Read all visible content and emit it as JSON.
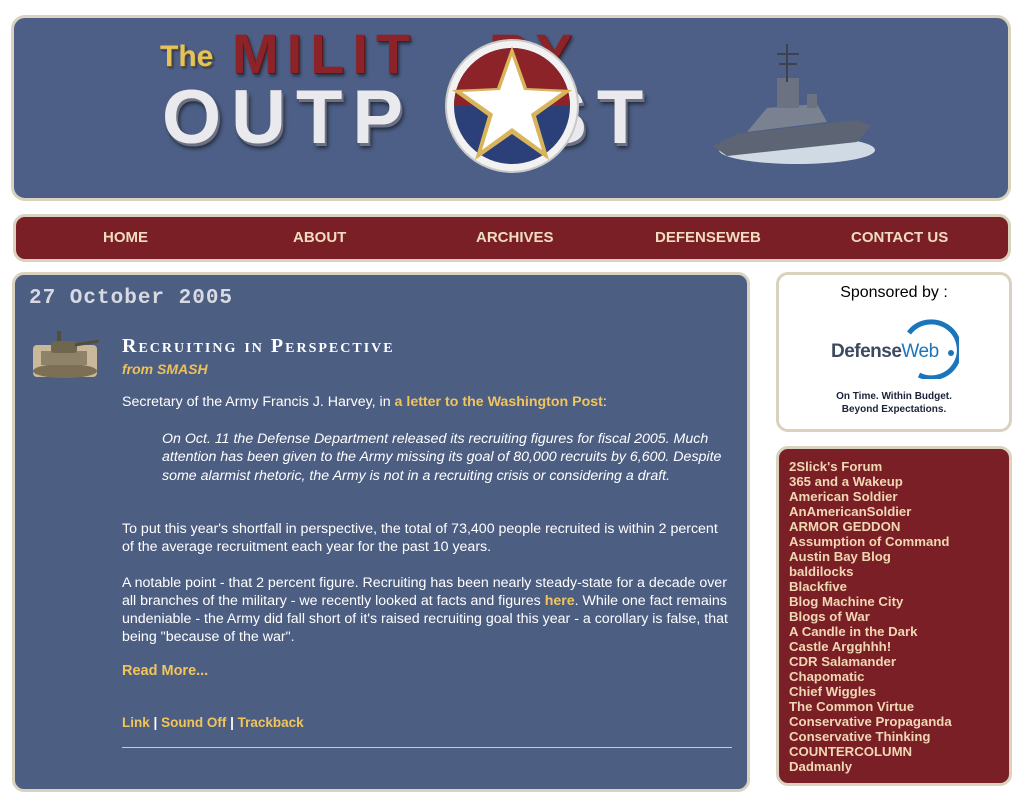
{
  "header": {
    "logo_the": "The",
    "logo_military": "MILIT   RY",
    "logo_outpost": "OUTP    ST"
  },
  "nav": {
    "items": [
      {
        "label": "HOME"
      },
      {
        "label": "ABOUT"
      },
      {
        "label": "ARCHIVES"
      },
      {
        "label": "DEFENSEWEB"
      },
      {
        "label": "CONTACT US"
      }
    ]
  },
  "post": {
    "date": "27 October 2005",
    "title": "Recruiting in Perspective",
    "author": "from SMASH",
    "intro_prefix": "Secretary of the Army Francis J. Harvey, in ",
    "intro_link": "a letter to the Washington Post",
    "intro_suffix": ":",
    "quote": "On Oct. 11 the Defense Department released its recruiting figures for fiscal 2005. Much attention has been given to the Army missing its goal of 80,000 recruits by 6,600. Despite some alarmist rhetoric, the Army is not in a recruiting crisis or considering a draft.",
    "para2": "To put this year's shortfall in perspective, the total of 73,400 people recruited is within 2 percent of the average recruitment each year for the past 10 years.",
    "para3_prefix": "A notable point - that 2 percent figure. Recruiting has been nearly steady-state for a decade over all branches of the military - we recently looked at facts and figures ",
    "para3_link": "here",
    "para3_suffix": ". While one fact remains undeniable - the Army did fall short of it's raised recruiting goal this year - a corollary is false, that being \"because of the war\".",
    "read_more": "Read More...",
    "links": {
      "link": "Link",
      "sound_off": "Sound Off",
      "trackback": "Trackback",
      "separator": "|"
    }
  },
  "sponsor": {
    "title": "Sponsored by :",
    "logo_defense": "Defense",
    "logo_web": "Web",
    "tagline1": "On Time. Within Budget.",
    "tagline2": "Beyond Expectations."
  },
  "blogroll": [
    "2Slick's Forum",
    "365 and a Wakeup",
    "American Soldier",
    "AnAmericanSoldier",
    "ARMOR GEDDON",
    "Assumption of Command",
    "Austin Bay Blog",
    "baldilocks",
    "Blackfive",
    "Blog Machine City",
    "Blogs of War",
    "A Candle in the Dark",
    "Castle Argghhh!",
    "CDR Salamander",
    "Chapomatic",
    "Chief Wiggles",
    "The Common Virtue",
    "Conservative Propaganda",
    "Conservative Thinking",
    "COUNTERCOLUMN",
    "Dadmanly"
  ],
  "colors": {
    "header_bg": "#4d5f86",
    "nav_bg": "#7a1f25",
    "accent_gold": "#f2c55c",
    "border_cream": "#d8d2bf"
  }
}
